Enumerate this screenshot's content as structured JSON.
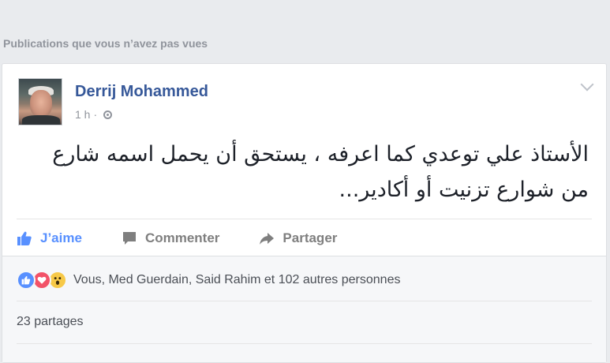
{
  "section_title": "Publications que vous n’avez pas vues",
  "post": {
    "author": "Derrij Mohammed",
    "time": "1 h",
    "separator": "·",
    "privacy_icon": "globe-icon",
    "text_line1": "الأستاذ علي توعدي كما اعرفه ، يستحق أن يحمل اسمه شارع",
    "text_line2": "من شوارع تزنيت أو أكادير...",
    "menu_icon": "chevron-down-icon"
  },
  "actions": {
    "like": "J’aime",
    "comment": "Commenter",
    "share": "Partager"
  },
  "footer": {
    "reactions_text": "Vous, Med Guerdain, Said Rahim et 102 autres personnes",
    "shares_text": "23 partages"
  },
  "colors": {
    "link_blue": "#365899",
    "like_blue": "#5890ff",
    "love_red": "#f25268",
    "wow_yellow": "#f7c948"
  }
}
